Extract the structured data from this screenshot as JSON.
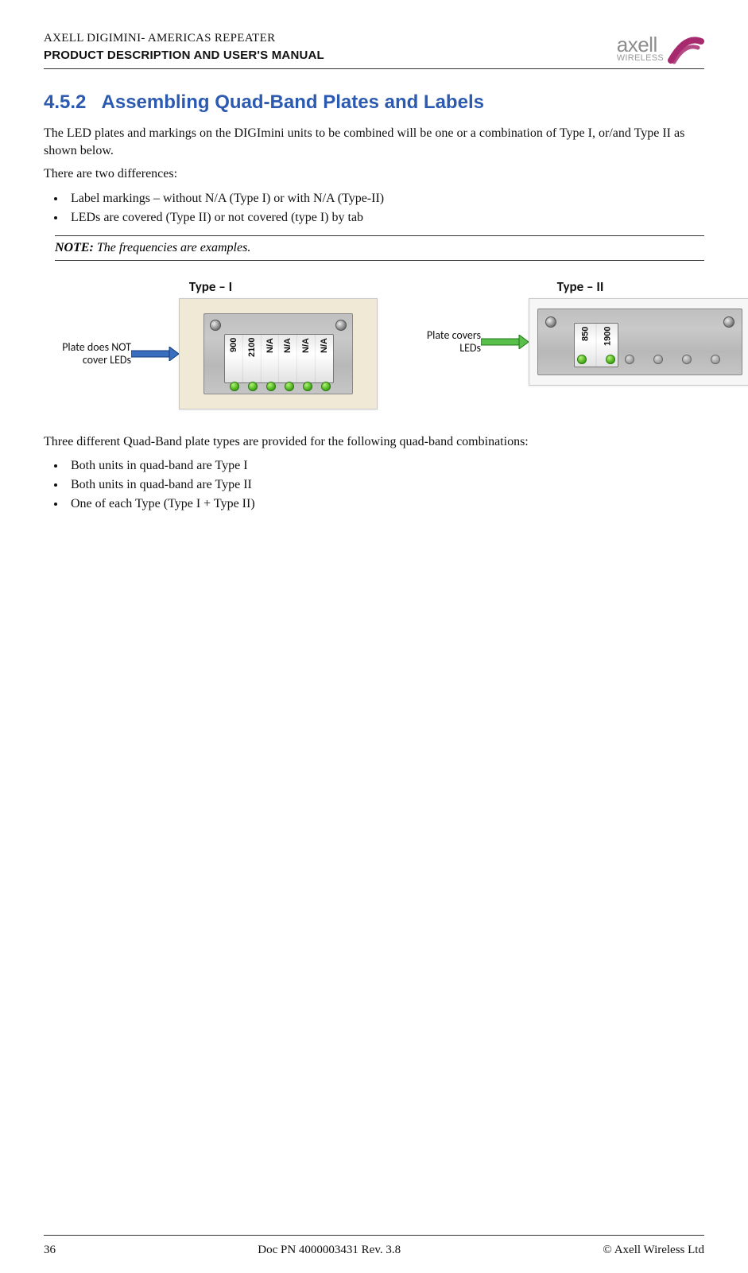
{
  "header": {
    "product_line": "AXELL DIGIMINI- AMERICAS REPEATER",
    "subtitle": "PRODUCT DESCRIPTION AND USER'S MANUAL",
    "logo_brand": "axell",
    "logo_sub": "WIRELESS"
  },
  "section": {
    "number": "4.5.2",
    "title": "Assembling Quad-Band Plates and Labels"
  },
  "paragraphs": {
    "p1": "The LED plates and markings on the DIGImini units to be combined will be one or a combination of Type I, or/and Type II as shown below.",
    "p2": "There are two differences:",
    "p3": "Three different Quad-Band plate types are provided for the following quad-band combinations:"
  },
  "diff_list": [
    "Label markings – without N/A (Type I) or with N/A (Type-II)",
    "LEDs are covered (Type II) or not covered (type I) by tab"
  ],
  "note": {
    "label": "NOTE:",
    "text": "The frequencies are examples."
  },
  "figure": {
    "type1": {
      "heading": "Type – I",
      "annotation_l1": "Plate does NOT",
      "annotation_l2": "cover LEDs",
      "labels": [
        "900",
        "2100",
        "N/A",
        "N/A",
        "N/A",
        "N/A"
      ]
    },
    "type2": {
      "heading": "Type – II",
      "annotation_l1": "Plate covers",
      "annotation_l2": "LEDs",
      "labels": [
        "850",
        "1900"
      ]
    }
  },
  "combo_list": [
    "Both units in quad-band are Type I",
    "Both units in quad-band are Type II",
    "One of each Type (Type I + Type II)"
  ],
  "footer": {
    "page": "36",
    "doc": "Doc PN 4000003431 Rev. 3.8",
    "copyright": "© Axell Wireless Ltd"
  }
}
